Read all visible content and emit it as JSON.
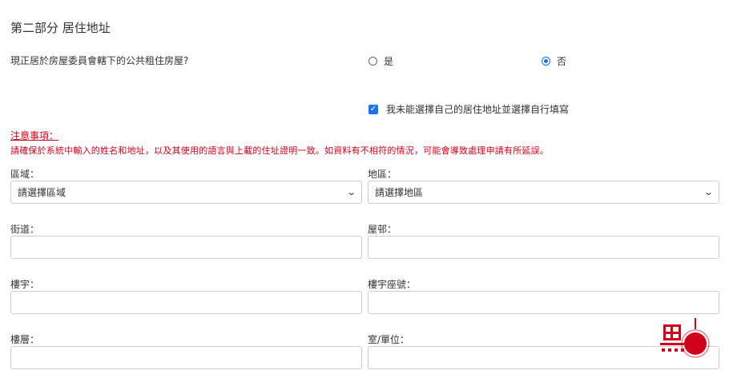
{
  "section": {
    "title": "第二部分  居住地址"
  },
  "question": {
    "text": "現正居於房屋委員會轄下的公共租住房屋?",
    "options": [
      {
        "label": "是",
        "selected": false
      },
      {
        "label": "否",
        "selected": true
      }
    ]
  },
  "manual_address": {
    "label": "我未能選擇自己的居住地址並選擇自行填寫",
    "checked": true
  },
  "notice": {
    "title": "注意事項：",
    "text": "請確保於系統中輸入的姓名和地址，以及其使用的語言與上載的住址證明一致。如資料有不相符的情況，可能會導致處理申請有所延誤。"
  },
  "fields": {
    "region": {
      "label": "區域：",
      "value": "請選擇區域"
    },
    "district": {
      "label": "地區：",
      "value": "請選擇地區"
    },
    "street": {
      "label": "街道：",
      "value": ""
    },
    "estate": {
      "label": "屋邨：",
      "value": ""
    },
    "building": {
      "label": "樓宇：",
      "value": ""
    },
    "block": {
      "label": "樓宇座號：",
      "value": ""
    },
    "floor": {
      "label": "樓層：",
      "value": ""
    },
    "unit": {
      "label": "室/單位：",
      "value": ""
    }
  },
  "icons": {
    "dropdown": "chevron-down-icon",
    "checkbox": "check-icon",
    "watermark": "logo-icon"
  },
  "colors": {
    "accent": "#1a73e8",
    "warning": "#d0021b",
    "border": "#cccccc"
  }
}
